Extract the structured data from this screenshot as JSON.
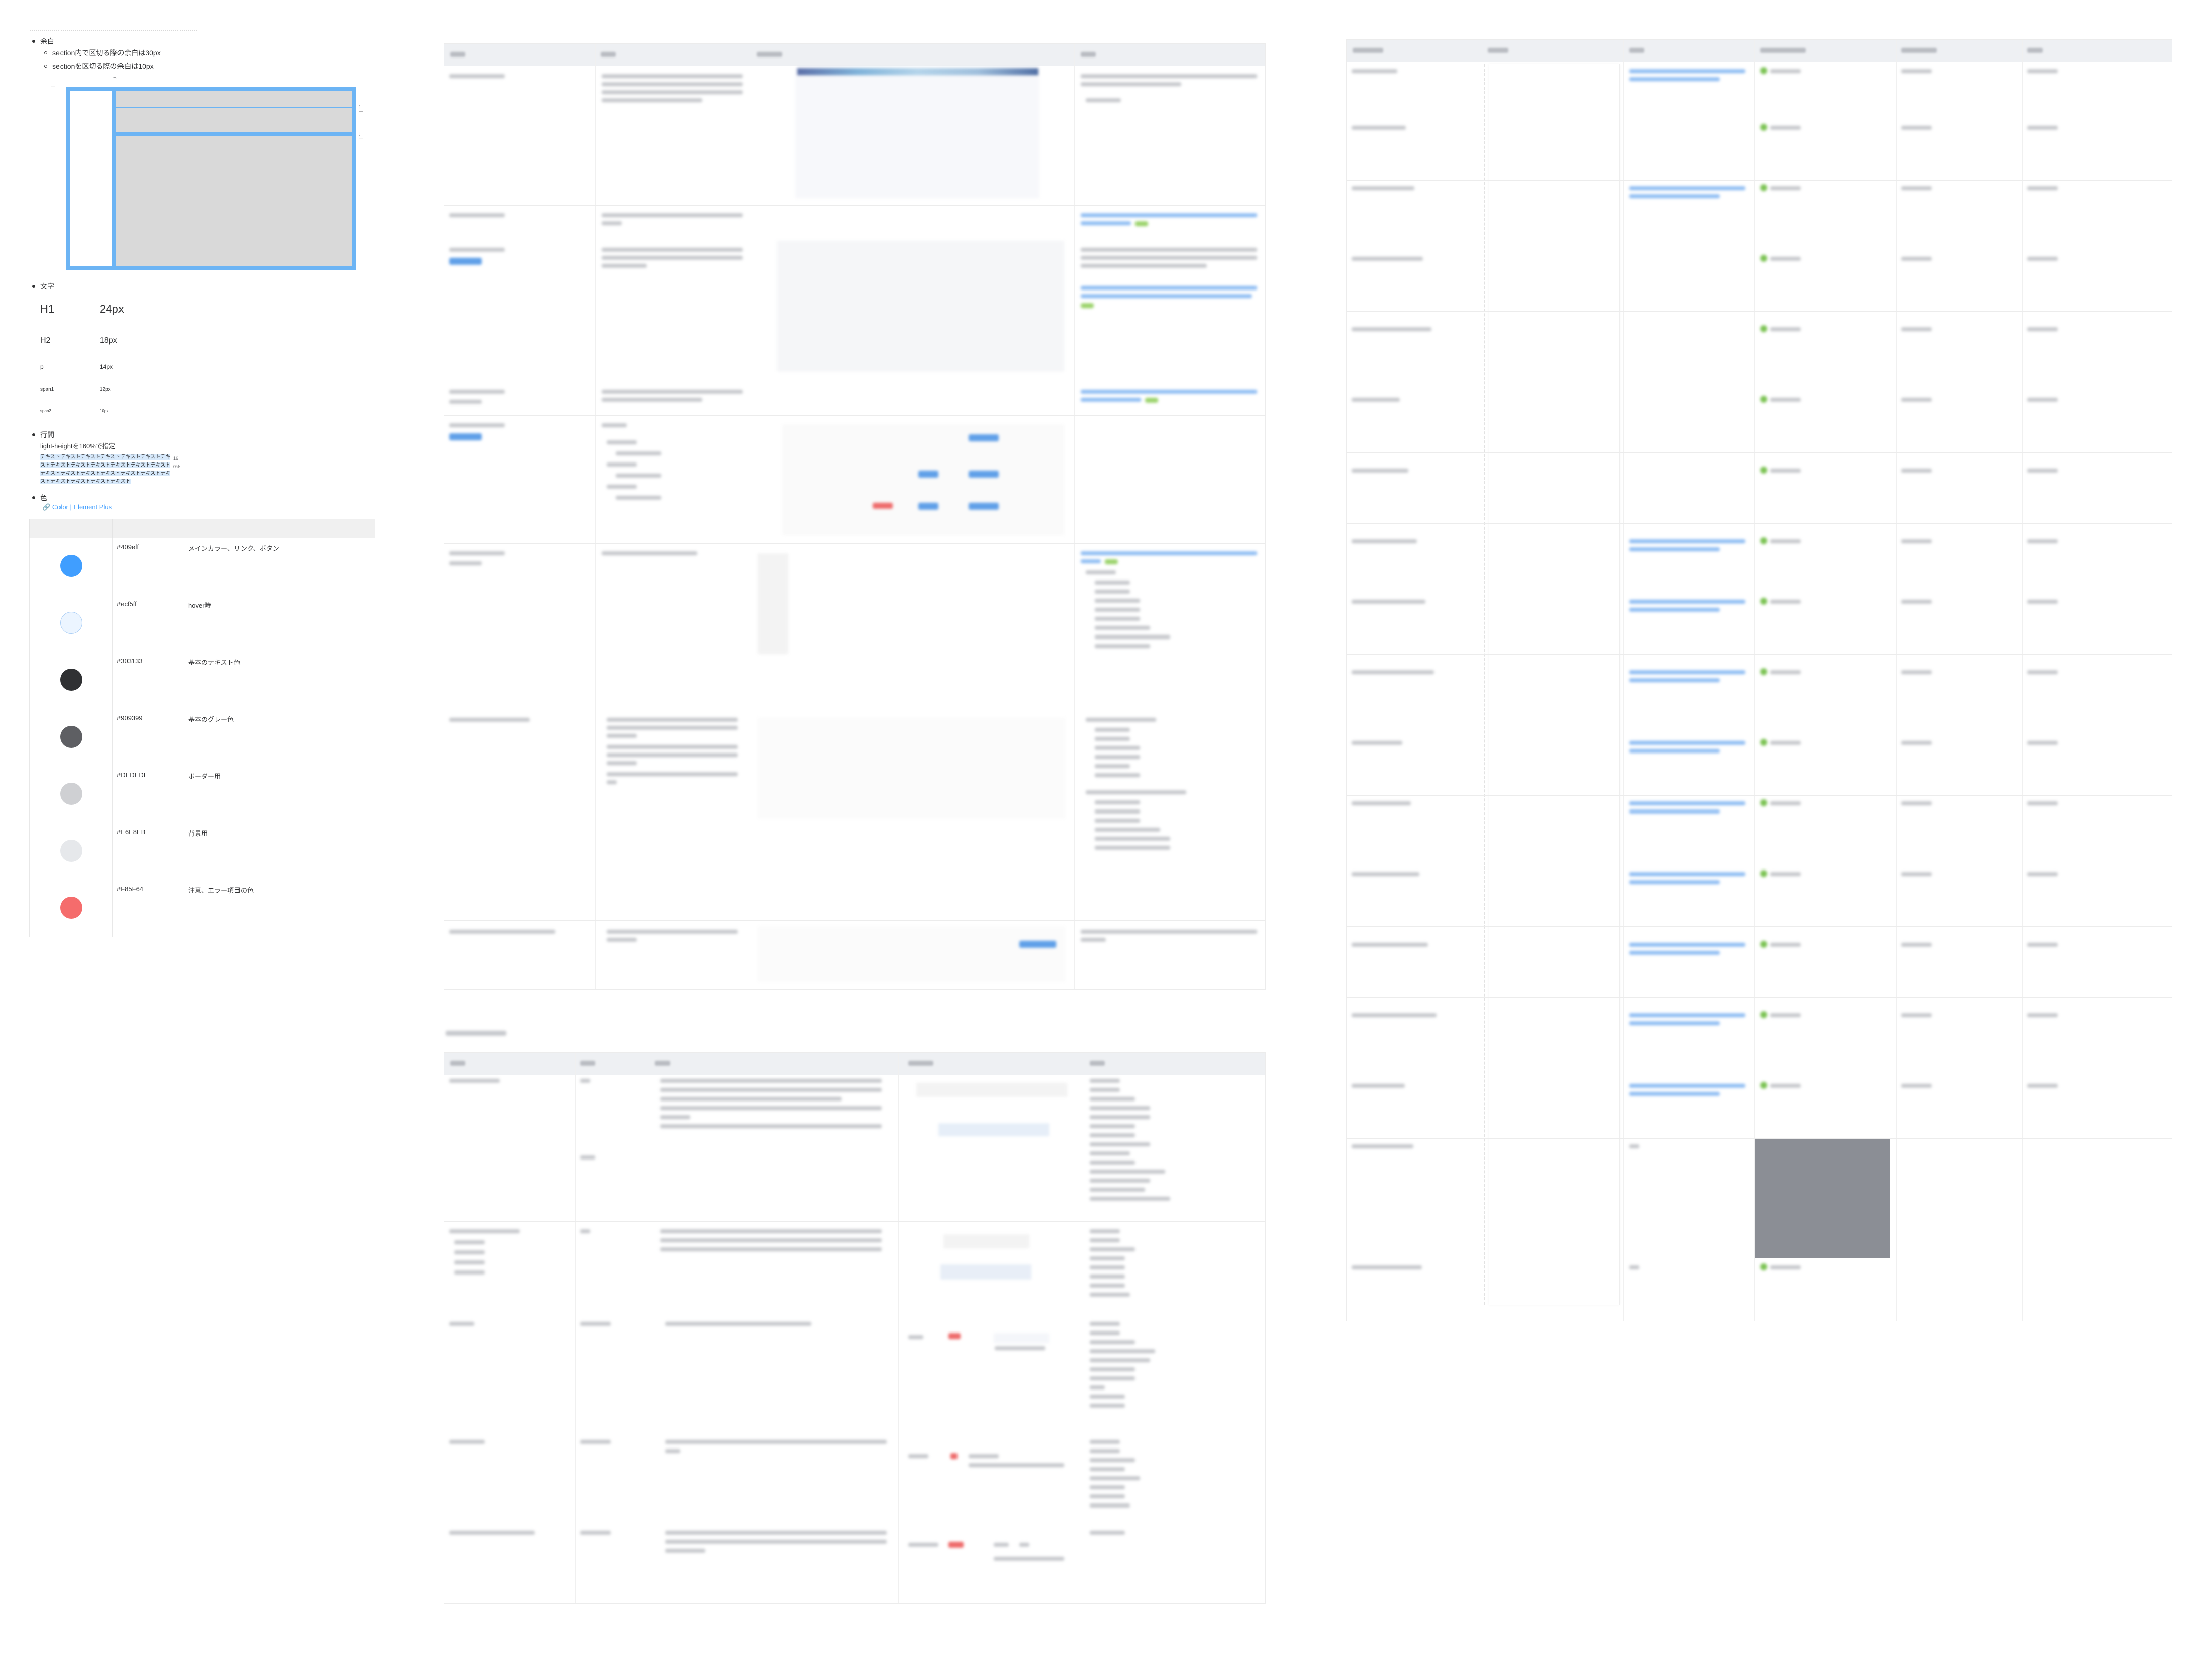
{
  "guidelines": {
    "spacing": {
      "heading": "余白",
      "items": [
        "section内で区切る際の余白は30px",
        "sectionを区切る際の余白は10px"
      ]
    },
    "typography": {
      "heading": "文字",
      "rows": [
        {
          "label": "H1",
          "value": "24px"
        },
        {
          "label": "H2",
          "value": "18px"
        },
        {
          "label": "p",
          "value": "14px"
        },
        {
          "label": "span1",
          "value": "12px"
        },
        {
          "label": "span2",
          "value": "10px"
        }
      ]
    },
    "line_height": {
      "heading": "行間",
      "note": "light-heightを160%で指定",
      "sample": "テキストテキストテキストテキストテキストテキストテキストテキストテキストテキストテキストテキストテキストテキストテキストテキストテキストテキストテキストテキストテキストテキストテキストテキスト",
      "tag": "160%"
    },
    "colors": {
      "heading": "色",
      "link": "Color | Element Plus",
      "rows": [
        {
          "hex": "#409eff",
          "swatch": "#409eff",
          "desc": "メインカラー、リンク、ボタン"
        },
        {
          "hex": "#ecf5ff",
          "swatch": "#ecf5ff",
          "desc": "hover時"
        },
        {
          "hex": "#303133",
          "swatch": "#303133",
          "desc": "基本のテキスト色"
        },
        {
          "hex": "#909399",
          "swatch": "#5e5f63",
          "desc": "基本のグレー色"
        },
        {
          "hex": "#DEDEDE",
          "swatch": "#cfd0d3",
          "desc": "ボーダー用"
        },
        {
          "hex": "#E6E8EB",
          "swatch": "#e6e8eb",
          "desc": "背景用"
        },
        {
          "hex": "#F85F64",
          "swatch": "#f56c6c",
          "desc": "注意、エラー項目の色"
        }
      ]
    }
  }
}
